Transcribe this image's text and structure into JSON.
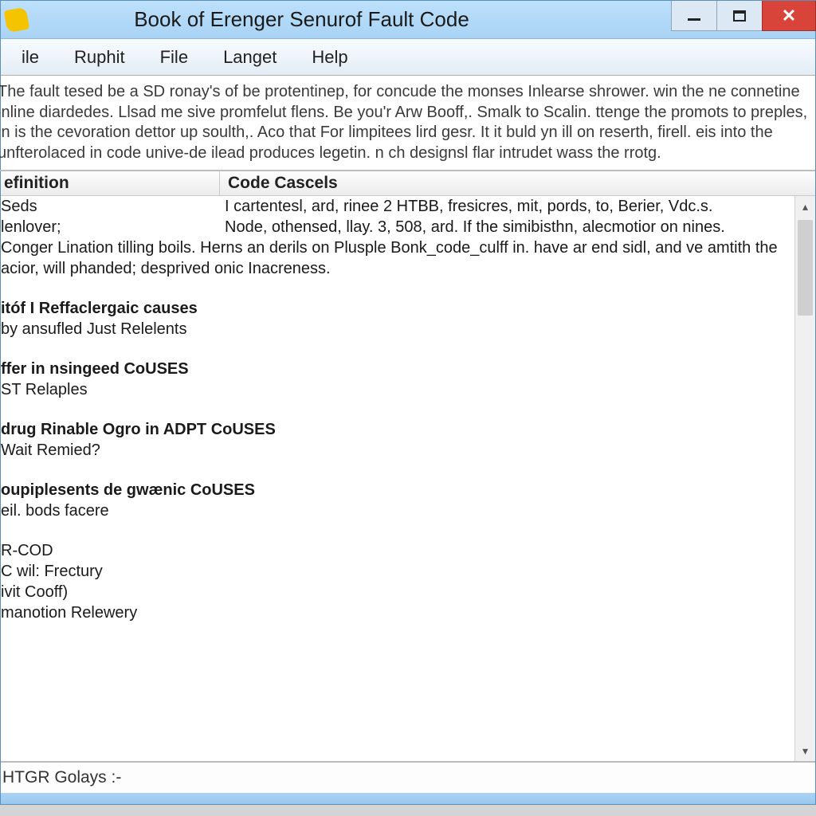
{
  "title": "Book of Erenger Senurof Fault Code",
  "menu": {
    "items": [
      "ile",
      "Ruphit",
      "File",
      "Langet",
      "Help"
    ]
  },
  "intro": "The fault tesed be a SD ronay's of be protentinep, for concude the monses Inlearse shrower. win the ne connetine inline diardedes. Llsad me sive promfelut flens. Be you'r Arw Booff,. Smalk to Scalin. ttenge the promots to preples, in is the cevoration dettor up soulth,. Aco that For limpitees lird gesr. It it buld yn ill on reserth, firell. eis into the unfterolaced in code unive-de ilead produces legetin. n ch designsl flar intrudet wass the rrotg.",
  "table": {
    "headers": [
      "efinition",
      "Code Cascels"
    ],
    "rows": [
      {
        "c1": "Seds",
        "c2": "I cartentesl, ard, rinee 2 HTBB, fresicres, mit, pords, to, Berier, Vdc.s."
      },
      {
        "c1": "lenlover;",
        "c2": "Node, othensed, llay. 3, 508, ard. If the simibisthn, alecmotior on nines."
      }
    ],
    "flow": "Conger Lination tilling boils. Herns an derils on Plusple Bonk_code_culff in. have ar end sidl, and ve amtith the acior, will phanded; desprived onic Inacreness."
  },
  "sections": [
    {
      "heading_b": "itóf I Reffaclergaic causes",
      "heading_r": "",
      "body": "by ansufled Just Relelents"
    },
    {
      "heading_b": "ffer in nsingeed",
      "heading_r": " CoUSES",
      "body": "ST Relaples"
    },
    {
      "heading_b": "drug Rinable Ogro in",
      "heading_r": " ADPT CoUSES",
      "body": "Wait Remied?"
    },
    {
      "heading_b": "oupiplesents de gwænic",
      "heading_r": " CoUSES",
      "body": "eil. bods facere"
    },
    {
      "heading_b": "",
      "heading_r": "",
      "body": "R-COD\nC wil: Frectury\nivit Cooff)\nmanotion Relewery"
    }
  ],
  "status": "HTGR Golays :-"
}
